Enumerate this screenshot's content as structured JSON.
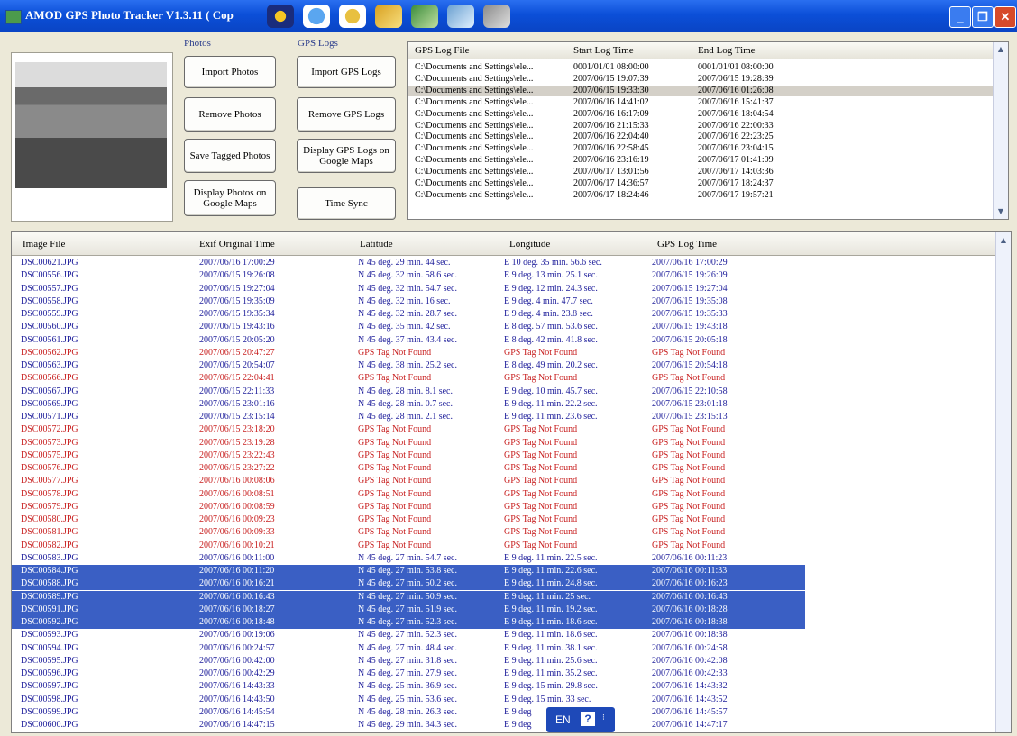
{
  "window": {
    "title": "AMOD GPS Photo Tracker V1.3.11   ( Cop",
    "min_label": "_",
    "max_label": "❐",
    "close_label": "✕"
  },
  "toolbar_icons": [
    "media-icon",
    "globe-icon",
    "settings-icon",
    "book-icon",
    "pen-icon",
    "edit-icon",
    "gear-icon"
  ],
  "photos_group": {
    "label": "Photos",
    "buttons": [
      "Import Photos",
      "Remove Photos",
      "Save Tagged Photos",
      "Display Photos on Google Maps"
    ]
  },
  "gps_group": {
    "label": "GPS Logs",
    "buttons": [
      "Import GPS Logs",
      "Remove GPS Logs",
      "Display GPS Logs on Google Maps",
      "Time Sync"
    ]
  },
  "gps_log_table": {
    "headers": [
      "GPS Log File",
      "Start Log Time",
      "End Log Time"
    ],
    "selected_index": 2,
    "rows": [
      [
        "C:\\Documents and Settings\\ele...",
        "0001/01/01 08:00:00",
        "0001/01/01 08:00:00"
      ],
      [
        "C:\\Documents and Settings\\ele...",
        "2007/06/15 19:07:39",
        "2007/06/15 19:28:39"
      ],
      [
        "C:\\Documents and Settings\\ele...",
        "2007/06/15 19:33:30",
        "2007/06/16 01:26:08"
      ],
      [
        "C:\\Documents and Settings\\ele...",
        "2007/06/16 14:41:02",
        "2007/06/16 15:41:37"
      ],
      [
        "C:\\Documents and Settings\\ele...",
        "2007/06/16 16:17:09",
        "2007/06/16 18:04:54"
      ],
      [
        "C:\\Documents and Settings\\ele...",
        "2007/06/16 21:15:33",
        "2007/06/16 22:00:33"
      ],
      [
        "C:\\Documents and Settings\\ele...",
        "2007/06/16 22:04:40",
        "2007/06/16 22:23:25"
      ],
      [
        "C:\\Documents and Settings\\ele...",
        "2007/06/16 22:58:45",
        "2007/06/16 23:04:15"
      ],
      [
        "C:\\Documents and Settings\\ele...",
        "2007/06/16 23:16:19",
        "2007/06/17 01:41:09"
      ],
      [
        "C:\\Documents and Settings\\ele...",
        "2007/06/17 13:01:56",
        "2007/06/17 14:03:36"
      ],
      [
        "C:\\Documents and Settings\\ele...",
        "2007/06/17 14:36:57",
        "2007/06/17 18:24:37"
      ],
      [
        "C:\\Documents and Settings\\ele...",
        "2007/06/17 18:24:46",
        "2007/06/17 19:57:21"
      ]
    ]
  },
  "image_table": {
    "headers": [
      "Image File",
      "Exif Original Time",
      "Latitude",
      "Longitude",
      "GPS Log Time"
    ],
    "rows": [
      {
        "file": "DSC00621.JPG",
        "exif": "2007/06/16 17:00:29",
        "lat": "N 45 deg. 29 min. 44 sec.",
        "lon": "E 10 deg. 35 min. 56.6 sec.",
        "gps": "2007/06/16 17:00:29",
        "state": "ok"
      },
      {
        "file": "DSC00556.JPG",
        "exif": "2007/06/15 19:26:08",
        "lat": "N 45 deg. 32 min. 58.6 sec.",
        "lon": "E 9 deg. 13 min. 25.1 sec.",
        "gps": "2007/06/15 19:26:09",
        "state": "ok"
      },
      {
        "file": "DSC00557.JPG",
        "exif": "2007/06/15 19:27:04",
        "lat": "N 45 deg. 32 min. 54.7 sec.",
        "lon": "E 9 deg. 12 min. 24.3 sec.",
        "gps": "2007/06/15 19:27:04",
        "state": "ok"
      },
      {
        "file": "DSC00558.JPG",
        "exif": "2007/06/15 19:35:09",
        "lat": "N 45 deg. 32 min. 16 sec.",
        "lon": "E 9 deg. 4 min. 47.7 sec.",
        "gps": "2007/06/15 19:35:08",
        "state": "ok"
      },
      {
        "file": "DSC00559.JPG",
        "exif": "2007/06/15 19:35:34",
        "lat": "N 45 deg. 32 min. 28.7 sec.",
        "lon": "E 9 deg. 4 min. 23.8 sec.",
        "gps": "2007/06/15 19:35:33",
        "state": "ok"
      },
      {
        "file": "DSC00560.JPG",
        "exif": "2007/06/15 19:43:16",
        "lat": "N 45 deg. 35 min. 42 sec.",
        "lon": "E 8 deg. 57 min. 53.6 sec.",
        "gps": "2007/06/15 19:43:18",
        "state": "ok"
      },
      {
        "file": "DSC00561.JPG",
        "exif": "2007/06/15 20:05:20",
        "lat": "N 45 deg. 37 min. 43.4 sec.",
        "lon": "E 8 deg. 42 min. 41.8 sec.",
        "gps": "2007/06/15 20:05:18",
        "state": "ok"
      },
      {
        "file": "DSC00562.JPG",
        "exif": "2007/06/15 20:47:27",
        "lat": "GPS Tag Not Found",
        "lon": "GPS Tag Not Found",
        "gps": "GPS Tag Not Found",
        "state": "nf"
      },
      {
        "file": "DSC00563.JPG",
        "exif": "2007/06/15 20:54:07",
        "lat": "N 45 deg. 38 min. 25.2 sec.",
        "lon": "E 8 deg. 49 min. 20.2 sec.",
        "gps": "2007/06/15 20:54:18",
        "state": "ok"
      },
      {
        "file": "DSC00566.JPG",
        "exif": "2007/06/15 22:04:41",
        "lat": "GPS Tag Not Found",
        "lon": "GPS Tag Not Found",
        "gps": "GPS Tag Not Found",
        "state": "nf"
      },
      {
        "file": "DSC00567.JPG",
        "exif": "2007/06/15 22:11:33",
        "lat": "N 45 deg. 28 min. 8.1 sec.",
        "lon": "E 9 deg. 10 min. 45.7 sec.",
        "gps": "2007/06/15 22:10:58",
        "state": "ok"
      },
      {
        "file": "DSC00569.JPG",
        "exif": "2007/06/15 23:01:16",
        "lat": "N 45 deg. 28 min. 0.7 sec.",
        "lon": "E 9 deg. 11 min. 22.2 sec.",
        "gps": "2007/06/15 23:01:18",
        "state": "ok"
      },
      {
        "file": "DSC00571.JPG",
        "exif": "2007/06/15 23:15:14",
        "lat": "N 45 deg. 28 min. 2.1 sec.",
        "lon": "E 9 deg. 11 min. 23.6 sec.",
        "gps": "2007/06/15 23:15:13",
        "state": "ok"
      },
      {
        "file": "DSC00572.JPG",
        "exif": "2007/06/15 23:18:20",
        "lat": "GPS Tag Not Found",
        "lon": "GPS Tag Not Found",
        "gps": "GPS Tag Not Found",
        "state": "nf"
      },
      {
        "file": "DSC00573.JPG",
        "exif": "2007/06/15 23:19:28",
        "lat": "GPS Tag Not Found",
        "lon": "GPS Tag Not Found",
        "gps": "GPS Tag Not Found",
        "state": "nf"
      },
      {
        "file": "DSC00575.JPG",
        "exif": "2007/06/15 23:22:43",
        "lat": "GPS Tag Not Found",
        "lon": "GPS Tag Not Found",
        "gps": "GPS Tag Not Found",
        "state": "nf"
      },
      {
        "file": "DSC00576.JPG",
        "exif": "2007/06/15 23:27:22",
        "lat": "GPS Tag Not Found",
        "lon": "GPS Tag Not Found",
        "gps": "GPS Tag Not Found",
        "state": "nf"
      },
      {
        "file": "DSC00577.JPG",
        "exif": "2007/06/16 00:08:06",
        "lat": "GPS Tag Not Found",
        "lon": "GPS Tag Not Found",
        "gps": "GPS Tag Not Found",
        "state": "nf"
      },
      {
        "file": "DSC00578.JPG",
        "exif": "2007/06/16 00:08:51",
        "lat": "GPS Tag Not Found",
        "lon": "GPS Tag Not Found",
        "gps": "GPS Tag Not Found",
        "state": "nf"
      },
      {
        "file": "DSC00579.JPG",
        "exif": "2007/06/16 00:08:59",
        "lat": "GPS Tag Not Found",
        "lon": "GPS Tag Not Found",
        "gps": "GPS Tag Not Found",
        "state": "nf"
      },
      {
        "file": "DSC00580.JPG",
        "exif": "2007/06/16 00:09:23",
        "lat": "GPS Tag Not Found",
        "lon": "GPS Tag Not Found",
        "gps": "GPS Tag Not Found",
        "state": "nf"
      },
      {
        "file": "DSC00581.JPG",
        "exif": "2007/06/16 00:09:33",
        "lat": "GPS Tag Not Found",
        "lon": "GPS Tag Not Found",
        "gps": "GPS Tag Not Found",
        "state": "nf"
      },
      {
        "file": "DSC00582.JPG",
        "exif": "2007/06/16 00:10:21",
        "lat": "GPS Tag Not Found",
        "lon": "GPS Tag Not Found",
        "gps": "GPS Tag Not Found",
        "state": "nf"
      },
      {
        "file": "DSC00583.JPG",
        "exif": "2007/06/16 00:11:00",
        "lat": "N 45 deg. 27 min. 54.7 sec.",
        "lon": "E 9 deg. 11 min. 22.5 sec.",
        "gps": "2007/06/16 00:11:23",
        "state": "ok"
      },
      {
        "file": "DSC00584.JPG",
        "exif": "2007/06/16 00:11:20",
        "lat": "N 45 deg. 27 min. 53.8 sec.",
        "lon": "E 9 deg. 11 min. 22.6 sec.",
        "gps": "2007/06/16 00:11:33",
        "state": "sel"
      },
      {
        "file": "DSC00588.JPG",
        "exif": "2007/06/16 00:16:21",
        "lat": "N 45 deg. 27 min. 50.2 sec.",
        "lon": "E 9 deg. 11 min. 24.8 sec.",
        "gps": "2007/06/16 00:16:23",
        "state": "sel"
      },
      {
        "file": "DSC00589.JPG",
        "exif": "2007/06/16 00:16:43",
        "lat": "N 45 deg. 27 min. 50.9 sec.",
        "lon": "E 9 deg. 11 min. 25 sec.",
        "gps": "2007/06/16 00:16:43",
        "state": "sel"
      },
      {
        "file": "DSC00591.JPG",
        "exif": "2007/06/16 00:18:27",
        "lat": "N 45 deg. 27 min. 51.9 sec.",
        "lon": "E 9 deg. 11 min. 19.2 sec.",
        "gps": "2007/06/16 00:18:28",
        "state": "sel"
      },
      {
        "file": "DSC00592.JPG",
        "exif": "2007/06/16 00:18:48",
        "lat": "N 45 deg. 27 min. 52.3 sec.",
        "lon": "E 9 deg. 11 min. 18.6 sec.",
        "gps": "2007/06/16 00:18:38",
        "state": "sel"
      },
      {
        "file": "DSC00593.JPG",
        "exif": "2007/06/16 00:19:06",
        "lat": "N 45 deg. 27 min. 52.3 sec.",
        "lon": "E 9 deg. 11 min. 18.6 sec.",
        "gps": "2007/06/16 00:18:38",
        "state": "ok"
      },
      {
        "file": "DSC00594.JPG",
        "exif": "2007/06/16 00:24:57",
        "lat": "N 45 deg. 27 min. 48.4 sec.",
        "lon": "E 9 deg. 11 min. 38.1 sec.",
        "gps": "2007/06/16 00:24:58",
        "state": "ok"
      },
      {
        "file": "DSC00595.JPG",
        "exif": "2007/06/16 00:42:00",
        "lat": "N 45 deg. 27 min. 31.8 sec.",
        "lon": "E 9 deg. 11 min. 25.6 sec.",
        "gps": "2007/06/16 00:42:08",
        "state": "ok"
      },
      {
        "file": "DSC00596.JPG",
        "exif": "2007/06/16 00:42:29",
        "lat": "N 45 deg. 27 min. 27.9 sec.",
        "lon": "E 9 deg. 11 min. 35.2 sec.",
        "gps": "2007/06/16 00:42:33",
        "state": "ok"
      },
      {
        "file": "DSC00597.JPG",
        "exif": "2007/06/16 14:43:33",
        "lat": "N 45 deg. 25 min. 36.9 sec.",
        "lon": "E 9 deg. 15 min. 29.8 sec.",
        "gps": "2007/06/16 14:43:32",
        "state": "ok"
      },
      {
        "file": "DSC00598.JPG",
        "exif": "2007/06/16 14:43:50",
        "lat": "N 45 deg. 25 min. 53.6 sec.",
        "lon": "E 9 deg. 15 min. 33 sec.",
        "gps": "2007/06/16 14:43:52",
        "state": "ok"
      },
      {
        "file": "DSC00599.JPG",
        "exif": "2007/06/16 14:45:54",
        "lat": "N 45 deg. 28 min. 26.3 sec.",
        "lon": "E 9 deg",
        "gps": "2007/06/16 14:45:57",
        "state": "ok"
      },
      {
        "file": "DSC00600.JPG",
        "exif": "2007/06/16 14:47:15",
        "lat": "N 45 deg. 29 min. 34.3 sec.",
        "lon": "E 9 deg",
        "gps": "2007/06/16 14:47:17",
        "state": "ok"
      }
    ]
  },
  "language_bar": {
    "lang": "EN",
    "help": "?"
  },
  "colors": {
    "title_bar": "#0b4fd8",
    "found_text": "#1d1d9a",
    "not_found_text": "#c82020",
    "selection": "#3a5fc4"
  }
}
